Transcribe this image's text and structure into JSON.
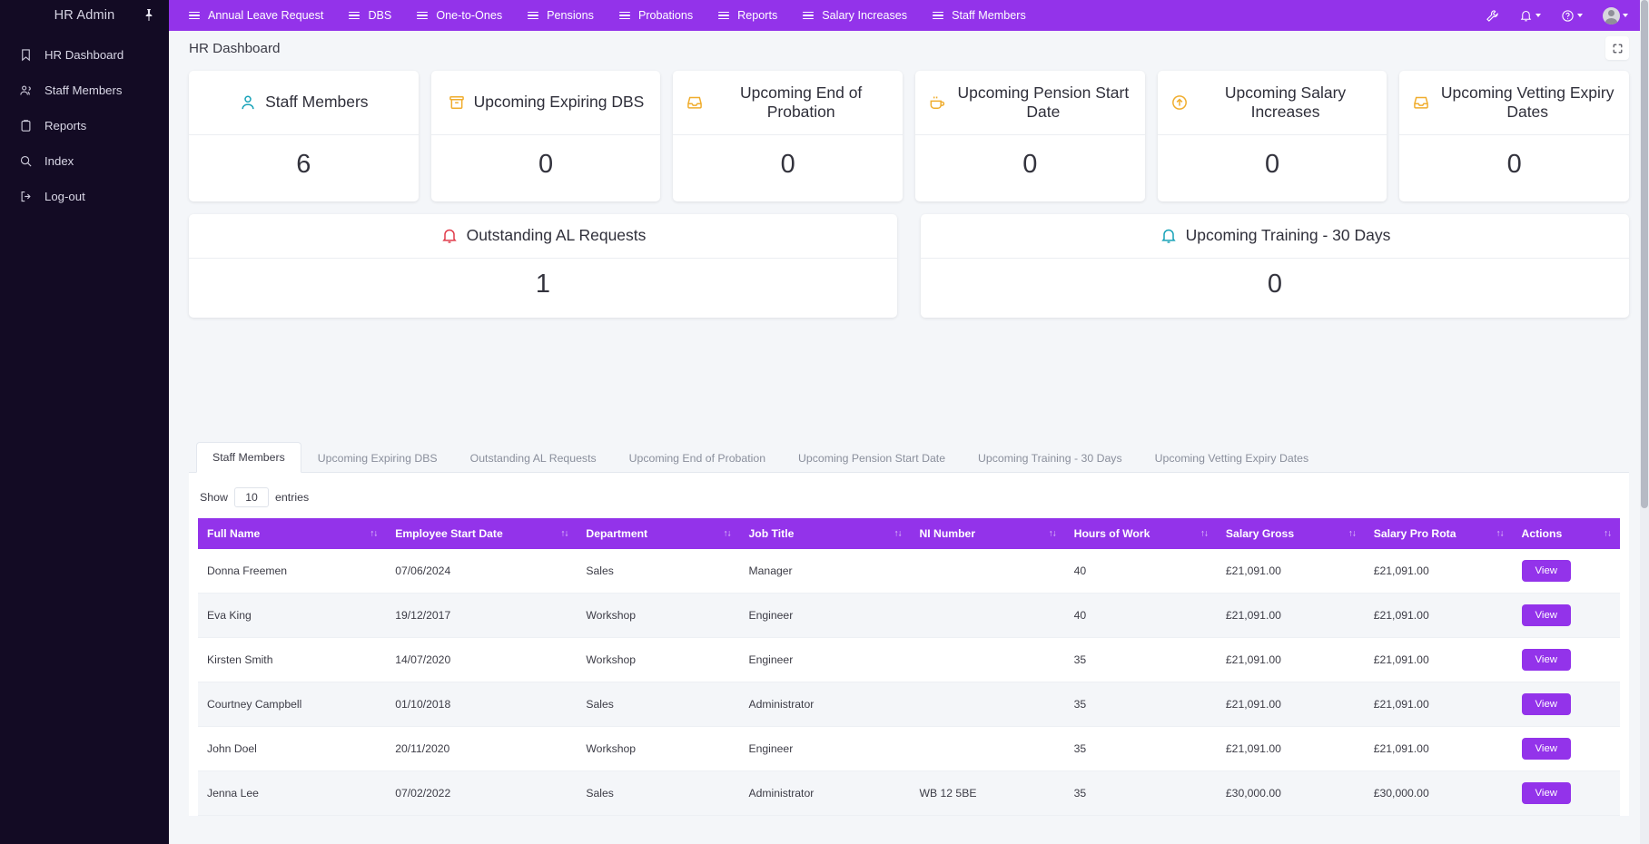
{
  "sidebar": {
    "brand": "HR Admin",
    "pin_icon": "pin-icon",
    "items": [
      {
        "label": "HR Dashboard",
        "icon": "bookmark-icon"
      },
      {
        "label": "Staff Members",
        "icon": "users-icon"
      },
      {
        "label": "Reports",
        "icon": "clipboard-icon"
      },
      {
        "label": "Index",
        "icon": "search-icon"
      },
      {
        "label": "Log-out",
        "icon": "logout-icon"
      }
    ]
  },
  "topbar": {
    "accent_color": "#9333ea",
    "items": [
      {
        "label": "Annual Leave Request"
      },
      {
        "label": "DBS"
      },
      {
        "label": "One-to-Ones"
      },
      {
        "label": "Pensions"
      },
      {
        "label": "Probations"
      },
      {
        "label": "Reports"
      },
      {
        "label": "Salary Increases"
      },
      {
        "label": "Staff Members"
      }
    ],
    "right_icons": [
      {
        "name": "wrench-icon",
        "caret": false
      },
      {
        "name": "bell-icon",
        "caret": true
      },
      {
        "name": "help-circle-icon",
        "caret": true
      },
      {
        "name": "user-avatar",
        "caret": true
      }
    ]
  },
  "page": {
    "title": "HR Dashboard",
    "fullscreen_icon": "fullscreen-icon"
  },
  "stat_cards": [
    {
      "title": "Staff Members",
      "value": "6",
      "icon": "user-icon",
      "icon_color": "#17a2b8"
    },
    {
      "title": "Upcoming Expiring DBS",
      "value": "0",
      "icon": "archive-icon",
      "icon_color": "#f0ad2e"
    },
    {
      "title": "Upcoming End of Probation",
      "value": "0",
      "icon": "inbox-icon",
      "icon_color": "#f0ad2e"
    },
    {
      "title": "Upcoming Pension Start Date",
      "value": "0",
      "icon": "coffee-icon",
      "icon_color": "#f0ad2e"
    },
    {
      "title": "Upcoming Salary Increases",
      "value": "0",
      "icon": "arrow-up-circle-icon",
      "icon_color": "#f0ad2e"
    },
    {
      "title": "Upcoming Vetting Expiry Dates",
      "value": "0",
      "icon": "inbox-icon",
      "icon_color": "#f0ad2e"
    }
  ],
  "wide_cards": [
    {
      "title": "Outstanding AL Requests",
      "value": "1",
      "icon": "bell-icon",
      "icon_color": "#e03b4a"
    },
    {
      "title": "Upcoming Training - 30 Days",
      "value": "0",
      "icon": "bell-icon",
      "icon_color": "#17a2b8"
    }
  ],
  "tabs": [
    {
      "label": "Staff Members",
      "active": true
    },
    {
      "label": "Upcoming Expiring DBS",
      "active": false
    },
    {
      "label": "Outstanding AL Requests",
      "active": false
    },
    {
      "label": "Upcoming End of Probation",
      "active": false
    },
    {
      "label": "Upcoming Pension Start Date",
      "active": false
    },
    {
      "label": "Upcoming Training - 30 Days",
      "active": false
    },
    {
      "label": "Upcoming Vetting Expiry Dates",
      "active": false
    }
  ],
  "table_controls": {
    "show_label": "Show",
    "entries_value": "10",
    "entries_label": "entries"
  },
  "table": {
    "columns": [
      "Full Name",
      "Employee Start Date",
      "Department",
      "Job Title",
      "NI Number",
      "Hours of Work",
      "Salary Gross",
      "Salary Pro Rota",
      "Actions"
    ],
    "action_label": "View",
    "rows": [
      {
        "full_name": "Donna Freemen",
        "start_date": "07/06/2024",
        "department": "Sales",
        "job_title": "Manager",
        "ni_number": "",
        "hours": "40",
        "salary_gross": "£21,091.00",
        "salary_pro_rota": "£21,091.00"
      },
      {
        "full_name": "Eva King",
        "start_date": "19/12/2017",
        "department": "Workshop",
        "job_title": "Engineer",
        "ni_number": "",
        "hours": "40",
        "salary_gross": "£21,091.00",
        "salary_pro_rota": "£21,091.00"
      },
      {
        "full_name": "Kirsten Smith",
        "start_date": "14/07/2020",
        "department": "Workshop",
        "job_title": "Engineer",
        "ni_number": "",
        "hours": "35",
        "salary_gross": "£21,091.00",
        "salary_pro_rota": "£21,091.00"
      },
      {
        "full_name": "Courtney Campbell",
        "start_date": "01/10/2018",
        "department": "Sales",
        "job_title": "Administrator",
        "ni_number": "",
        "hours": "35",
        "salary_gross": "£21,091.00",
        "salary_pro_rota": "£21,091.00"
      },
      {
        "full_name": "John Doel",
        "start_date": "20/11/2020",
        "department": "Workshop",
        "job_title": "Engineer",
        "ni_number": "",
        "hours": "35",
        "salary_gross": "£21,091.00",
        "salary_pro_rota": "£21,091.00"
      },
      {
        "full_name": "Jenna Lee",
        "start_date": "07/02/2022",
        "department": "Sales",
        "job_title": "Administrator",
        "ni_number": "WB 12 5BE",
        "hours": "35",
        "salary_gross": "£30,000.00",
        "salary_pro_rota": "£30,000.00"
      }
    ]
  }
}
